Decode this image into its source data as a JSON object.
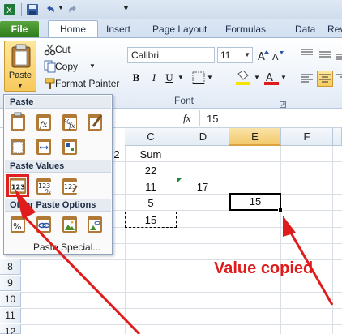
{
  "tabs": {
    "file": "File",
    "home": "Home",
    "insert": "Insert",
    "page_layout": "Page Layout",
    "formulas": "Formulas",
    "data": "Data",
    "review": "Rev"
  },
  "clipboard": {
    "paste": "Paste",
    "cut": "Cut",
    "copy": "Copy",
    "format_painter": "Format Painter"
  },
  "font": {
    "name": "Calibri",
    "size": "11",
    "group_label": "Font",
    "bold": "B",
    "italic": "I",
    "underline": "U"
  },
  "formula_bar": {
    "fx": "fx",
    "value": "15"
  },
  "grid": {
    "columns": [
      "C",
      "D",
      "E",
      "F"
    ],
    "selected_column": "E",
    "rows": [
      "8",
      "9",
      "10",
      "11",
      "12"
    ],
    "cells": {
      "c_sum": "Sum",
      "b_partial": "2",
      "c3": "22",
      "c4": "11",
      "d4": "17",
      "c5": "5",
      "e5": "15",
      "c6": "15"
    }
  },
  "paste_menu": {
    "paste_header": "Paste",
    "values_header": "Paste Values",
    "other_header": "Other Paste Options",
    "paste_special": "Paste Special..."
  },
  "annotation": {
    "text": "Value copied",
    "color": "#e01b1b"
  }
}
